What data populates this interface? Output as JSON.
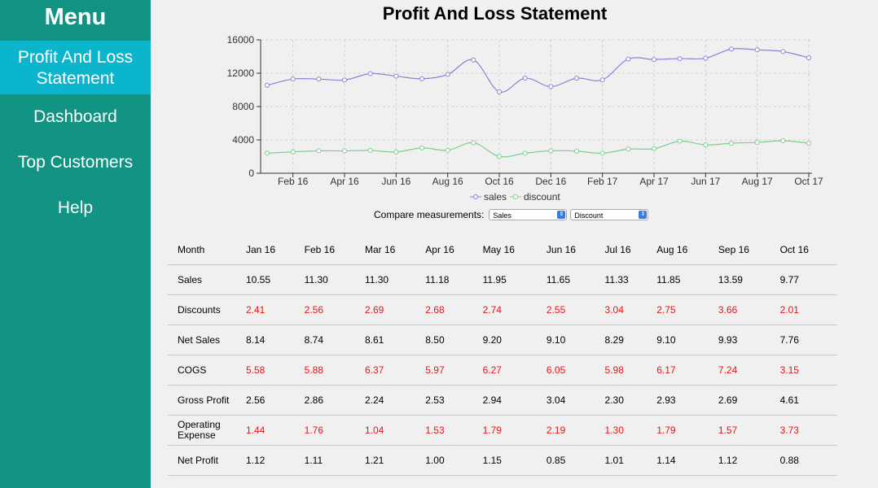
{
  "sidebar": {
    "title": "Menu",
    "items": [
      {
        "label": "Profit And Loss Statement",
        "active": true
      },
      {
        "label": "Dashboard",
        "active": false
      },
      {
        "label": "Top Customers",
        "active": false
      },
      {
        "label": "Help",
        "active": false
      }
    ]
  },
  "page_title": "Profit And Loss Statement",
  "chart_data": {
    "type": "line",
    "y_ticks": [
      "0",
      "4000",
      "8000",
      "12000",
      "16000"
    ],
    "ylim": [
      0,
      16000
    ],
    "x_tick_labels": [
      "Feb 16",
      "Apr 16",
      "Jun 16",
      "Aug 16",
      "Oct 16",
      "Dec 16",
      "Feb 17",
      "Apr 17",
      "Jun 17",
      "Aug 17",
      "Oct 17"
    ],
    "x": [
      "Jan 16",
      "Feb 16",
      "Mar 16",
      "Apr 16",
      "May 16",
      "Jun 16",
      "Jul 16",
      "Aug 16",
      "Sep 16",
      "Oct 16",
      "Nov 16",
      "Dec 16",
      "Jan 17",
      "Feb 17",
      "Mar 17",
      "Apr 17",
      "May 17",
      "Jun 17",
      "Jul 17",
      "Aug 17",
      "Sep 17",
      "Oct 17"
    ],
    "series": [
      {
        "name": "sales",
        "color": "#8b82d6",
        "values": [
          10550,
          11300,
          11300,
          11180,
          11950,
          11650,
          11330,
          11850,
          13590,
          9770,
          11400,
          10400,
          11400,
          11200,
          13700,
          13650,
          13750,
          13800,
          14900,
          14800,
          14600,
          13850
        ]
      },
      {
        "name": "discount",
        "color": "#7ccc8e",
        "values": [
          2410,
          2560,
          2690,
          2680,
          2740,
          2550,
          3040,
          2750,
          3660,
          2010,
          2400,
          2700,
          2650,
          2400,
          2900,
          2950,
          3850,
          3400,
          3600,
          3700,
          3900,
          3600
        ]
      }
    ],
    "grid": true,
    "legend_position": "bottom-center"
  },
  "compare": {
    "label": "Compare measurements:",
    "select1": "Sales",
    "select2": "Discount"
  },
  "table": {
    "headers": [
      "Month",
      "Jan 16",
      "Feb 16",
      "Mar 16",
      "Apr 16",
      "May 16",
      "Jun 16",
      "Jul 16",
      "Aug 16",
      "Sep 16",
      "Oct 16"
    ],
    "rows": [
      {
        "label": "Sales",
        "negative": false,
        "values": [
          "10.55",
          "11.30",
          "11.30",
          "11.18",
          "11.95",
          "11.65",
          "11.33",
          "11.85",
          "13.59",
          "9.77"
        ]
      },
      {
        "label": "Discounts",
        "negative": true,
        "values": [
          "2.41",
          "2.56",
          "2.69",
          "2.68",
          "2.74",
          "2.55",
          "3.04",
          "2.75",
          "3.66",
          "2.01"
        ]
      },
      {
        "label": "Net Sales",
        "negative": false,
        "values": [
          "8.14",
          "8.74",
          "8.61",
          "8.50",
          "9.20",
          "9.10",
          "8.29",
          "9.10",
          "9.93",
          "7.76"
        ]
      },
      {
        "label": "COGS",
        "negative": true,
        "values": [
          "5.58",
          "5.88",
          "6.37",
          "5.97",
          "6.27",
          "6.05",
          "5.98",
          "6.17",
          "7.24",
          "3.15"
        ]
      },
      {
        "label": "Gross Profit",
        "negative": false,
        "values": [
          "2.56",
          "2.86",
          "2.24",
          "2.53",
          "2.94",
          "3.04",
          "2.30",
          "2.93",
          "2.69",
          "4.61"
        ]
      },
      {
        "label": "Operating Expense",
        "negative": true,
        "values": [
          "1.44",
          "1.76",
          "1.04",
          "1.53",
          "1.79",
          "2.19",
          "1.30",
          "1.79",
          "1.57",
          "3.73"
        ]
      },
      {
        "label": "Net Profit",
        "negative": false,
        "values": [
          "1.12",
          "1.11",
          "1.21",
          "1.00",
          "1.15",
          "0.85",
          "1.01",
          "1.14",
          "1.12",
          "0.88"
        ]
      }
    ]
  }
}
